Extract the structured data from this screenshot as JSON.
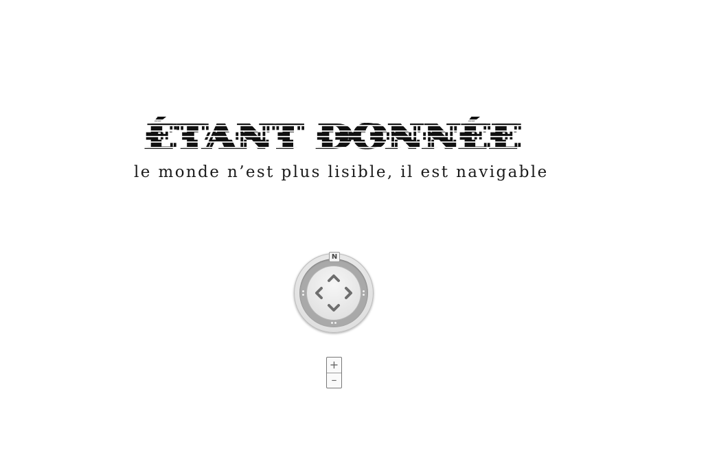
{
  "header": {
    "title": "ÉTANT DONNÉE",
    "subtitle": "le monde n’est plus lisible, il est navigable"
  },
  "navigation_control": {
    "north_label": "N",
    "arrows": [
      "up-arrow-icon",
      "down-arrow-icon",
      "left-arrow-icon",
      "right-arrow-icon"
    ],
    "accent_color": "#a9a9a9",
    "arrow_color": "#6e6e6e"
  },
  "zoom": {
    "zoom_in_label": "+",
    "zoom_out_label": "–"
  }
}
